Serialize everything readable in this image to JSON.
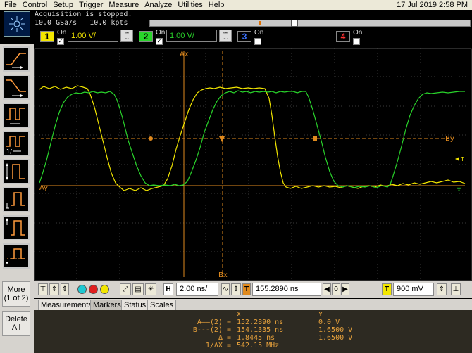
{
  "menu": [
    "File",
    "Control",
    "Setup",
    "Trigger",
    "Measure",
    "Analyze",
    "Utilities",
    "Help"
  ],
  "datetime": "17 Jul 2019  2:58 PM",
  "acquisition": {
    "status": "Acquisition is stopped.",
    "rate": "10.0 GSa/s",
    "memory": "10.0 kpts"
  },
  "channels": [
    {
      "num": "1",
      "on_label": "On",
      "checked": "✓",
      "scale": "1.00 V/",
      "color": "#f2e600"
    },
    {
      "num": "2",
      "on_label": "On",
      "checked": "✓",
      "scale": "1.00 V/",
      "color": "#29d42b"
    },
    {
      "num": "3",
      "on_label": "On",
      "checked": "",
      "scale": "",
      "color": "#3a72ff"
    },
    {
      "num": "4",
      "on_label": "On",
      "checked": "",
      "scale": "",
      "color": "#ff3030"
    }
  ],
  "left_buttons": {
    "more": "More",
    "more_page": "(1 of 2)",
    "delete": "Delete",
    "delete_all": "All"
  },
  "markers": {
    "ax": "Ax",
    "bx": "Bx",
    "ay": "Ay",
    "by": "By"
  },
  "controls": {
    "horizontal_label": "H",
    "timebase": "2.00 ns/",
    "trigger_label": "T",
    "position": "155.2890 ns",
    "delay": "0",
    "trigger_level_label": "T",
    "trigger_level": "900 mV"
  },
  "tabs": [
    "Measurements",
    "Markers",
    "Status",
    "Scales"
  ],
  "active_tab": "Markers",
  "readout": {
    "col_x": "X",
    "col_y": "Y",
    "rows": [
      {
        "label": "A——(2) =",
        "x": "152.2890 ns",
        "y": "0.0 V"
      },
      {
        "label": "B---(2) =",
        "x": "154.1335 ns",
        "y": "1.6500 V"
      },
      {
        "label": "Δ =",
        "x": "1.8445 ns",
        "y": "1.6500 V"
      },
      {
        "label": "1/ΔX =",
        "x": "542.15 MHz",
        "y": ""
      }
    ]
  },
  "colors": {
    "ch1": "#f2e600",
    "ch2": "#29d42b",
    "marker": "#e08a1e",
    "grid": "#3a3a3a"
  }
}
